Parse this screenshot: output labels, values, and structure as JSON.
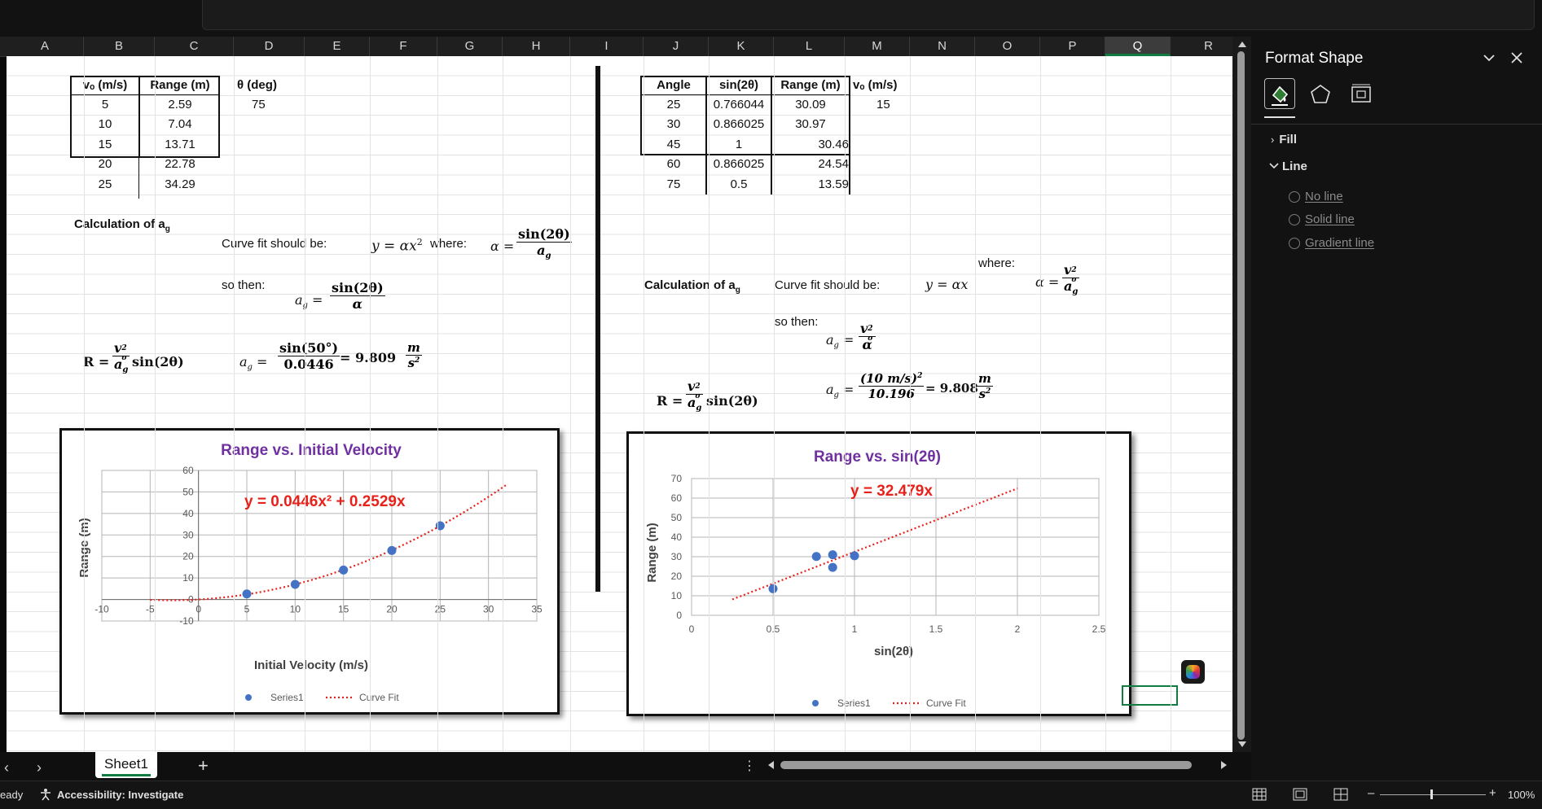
{
  "columns": [
    "A",
    "B",
    "C",
    "D",
    "E",
    "F",
    "G",
    "H",
    "I",
    "J",
    "K",
    "L",
    "M",
    "N",
    "O",
    "P",
    "Q",
    "R"
  ],
  "selected_column": "Q",
  "table1": {
    "headers": [
      "vₒ (m/s)",
      "Range (m)"
    ],
    "rows": [
      [
        "5",
        "2.59"
      ],
      [
        "10",
        "7.04"
      ],
      [
        "15",
        "13.71"
      ],
      [
        "20",
        "22.78"
      ],
      [
        "25",
        "34.29"
      ]
    ],
    "theta_label": "θ (deg)",
    "theta_value": "75"
  },
  "left_text": {
    "calc_label": "Calculation of a",
    "calc_sub": "g",
    "curve_fit": "Curve fit should be:",
    "eq_y": "y = αx",
    "eq_y_exp": "2",
    "where": "where:",
    "alpha": "α =",
    "alpha_num": "sin(2θ)",
    "alpha_den": "a",
    "alpha_den_sub": "g",
    "so_then": "so then:",
    "ag": "a",
    "ag_sub": "g",
    "ag_eq": " =",
    "ag_num": "sin(2θ)",
    "ag_den": "α",
    "r_lhs": "R =",
    "r_num": "v",
    "r_num_sub": "o",
    "r_num_sup": "2",
    "r_den": "a",
    "r_den_sub": "g",
    "r_tail": "sin(2θ)",
    "calc2_num": "sin(50°)",
    "calc2_den": "0.0446",
    "calc2_result": "= 9.809",
    "unit_num": "m",
    "unit_den": "s",
    "unit_den_sup": "2"
  },
  "table2": {
    "headers": [
      "Angle",
      "sin(2θ)",
      "Range (m)",
      "vₒ (m/s)"
    ],
    "rows": [
      [
        "25",
        "0.766044",
        "30.09"
      ],
      [
        "30",
        "0.866025",
        "30.97"
      ],
      [
        "45",
        "1",
        "30.46"
      ],
      [
        "60",
        "0.866025",
        "24.54"
      ],
      [
        "75",
        "0.5",
        "13.59"
      ]
    ],
    "v0_value": "15"
  },
  "right_text": {
    "calc_label": "Calculation of a",
    "calc_sub": "g",
    "curve_fit": "Curve fit should be:",
    "eq_y": "y = αx",
    "where": "where:",
    "alpha": "α =",
    "alpha_num": "v",
    "alpha_num_sub": "o",
    "alpha_num_sup": "2",
    "alpha_den": "a",
    "alpha_den_sub": "g",
    "so_then": "so then:",
    "ag": "a",
    "ag_sub": "g",
    "ag_eq": " =",
    "ag_num": "v",
    "ag_num_sub": "o",
    "ag_num_sup": "2",
    "ag_den": "α",
    "r_lhs": "R =",
    "r_tail": "sin(2θ)",
    "calc_num": "(10 m/s)",
    "calc_num_sup": "2",
    "calc_den": "10.196",
    "calc_result": "= 9.808",
    "unit_num": "m",
    "unit_den": "s",
    "unit_den_sup": "2"
  },
  "chart_data": [
    {
      "type": "scatter",
      "title": "Range vs. Initial Velocity",
      "xlabel": "Initial Velocity (m/s)",
      "ylabel": "Range (m)",
      "xlim": [
        -10,
        35
      ],
      "ylim": [
        -10,
        60
      ],
      "xticks": [
        "-10",
        "-5",
        "0",
        "5",
        "10",
        "15",
        "20",
        "25",
        "30",
        "35"
      ],
      "yticks": [
        "-10",
        "0",
        "10",
        "20",
        "30",
        "40",
        "50",
        "60"
      ],
      "grid": true,
      "legend": "bottom",
      "series": [
        {
          "name": "Series1",
          "x": [
            5,
            10,
            15,
            20,
            25
          ],
          "y": [
            2.59,
            7.04,
            13.71,
            22.78,
            34.29
          ],
          "color": "#4472c4"
        },
        {
          "name": "Curve Fit",
          "style": "dotted",
          "color": "#e8211a",
          "fit": {
            "a": 0.0446,
            "b": 0.2529
          },
          "x_range": [
            -5,
            32
          ]
        }
      ],
      "annotation": "y = 0.0446x² + 0.2529x",
      "annotation_color": "#e8211a"
    },
    {
      "type": "scatter",
      "title": "Range vs. sin(2θ)",
      "xlabel": "sin(2θ)",
      "ylabel": "Range (m)",
      "xlim": [
        0,
        2.5
      ],
      "ylim": [
        0,
        70
      ],
      "xticks": [
        "0",
        "0.5",
        "1",
        "1.5",
        "2",
        "2.5"
      ],
      "yticks": [
        "0",
        "10",
        "20",
        "30",
        "40",
        "50",
        "60",
        "70"
      ],
      "grid": true,
      "legend": "bottom",
      "series": [
        {
          "name": "Series1",
          "x": [
            0.766044,
            0.866025,
            1,
            0.866025,
            0.5
          ],
          "y": [
            30.09,
            30.97,
            30.46,
            24.54,
            13.59
          ],
          "color": "#4472c4"
        },
        {
          "name": "Curve Fit",
          "style": "dotted",
          "color": "#e8211a",
          "fit": {
            "a": 0,
            "b": 32.479
          },
          "x_range": [
            0.25,
            2
          ]
        }
      ],
      "annotation": "y = 32.479x",
      "annotation_color": "#e8211a"
    }
  ],
  "colors": {
    "purple_title": "#7030a0",
    "fit_red": "#e8211a",
    "marker_blue": "#4472c4",
    "excel_green": "#107c41"
  },
  "pane": {
    "title": "Format Shape",
    "tabs": [
      "fill-line-icon",
      "effects-icon",
      "size-properties-icon"
    ],
    "sections": [
      "Fill",
      "Line"
    ],
    "line_options": [
      "No line",
      "Solid line",
      "Gradient line"
    ]
  },
  "sheet_tab": "Sheet1",
  "status": {
    "ready": "eady",
    "accessibility": "Accessibility: Investigate",
    "zoom": "100%"
  }
}
